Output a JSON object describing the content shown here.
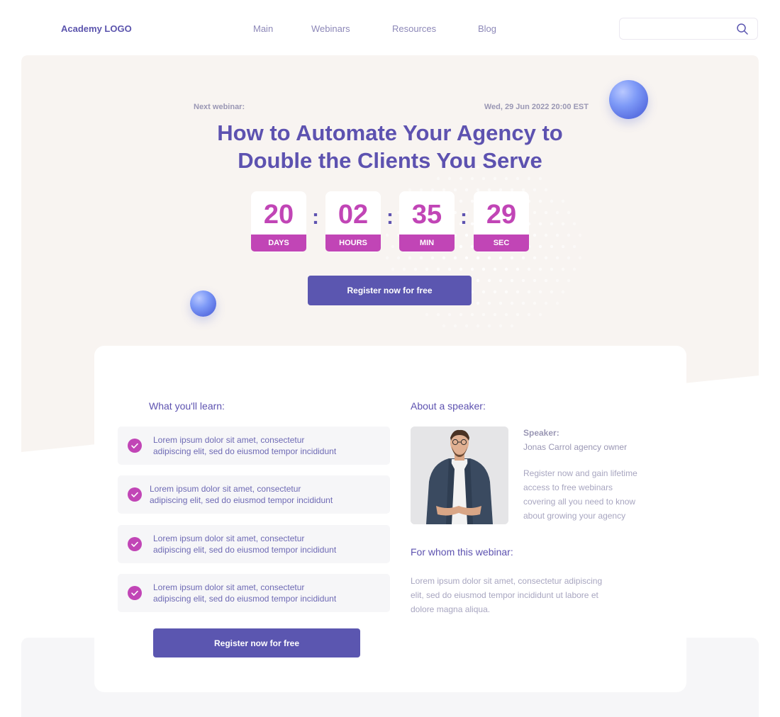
{
  "header": {
    "logo": "Academy LOGO",
    "nav": [
      "Main",
      "Webinars",
      "Resources",
      "Blog"
    ],
    "search_placeholder": ""
  },
  "hero": {
    "next_label": "Next webinar:",
    "date": "Wed, 29 Jun 2022 20:00 EST",
    "title_line1": "How to Automate Your Agency to",
    "title_line2": "Double the Clients You Serve",
    "countdown": [
      {
        "value": "20",
        "label": "DAYS"
      },
      {
        "value": "02",
        "label": "HOURS"
      },
      {
        "value": "35",
        "label": "MIN"
      },
      {
        "value": "29",
        "label": "SEC"
      }
    ],
    "separator": ":",
    "register_label": "Register now for free"
  },
  "learn": {
    "title": "What you'll learn:",
    "items": [
      {
        "line1": "Lorem ipsum dolor sit amet, consectetur",
        "line2": "adipiscing elit, sed do eiusmod tempor incididunt"
      },
      {
        "line1": "Lorem ipsum dolor sit amet, consectetur",
        "line2": "adipiscing elit, sed do eiusmod tempor incididunt"
      },
      {
        "line1": "Lorem ipsum dolor sit amet, consectetur",
        "line2": "adipiscing elit, sed do eiusmod tempor incididunt"
      },
      {
        "line1": "Lorem ipsum dolor sit amet, consectetur",
        "line2": "adipiscing elit, sed do eiusmod tempor incididunt"
      }
    ],
    "register_label": "Register now for free"
  },
  "speaker": {
    "title": "About a speaker:",
    "label": "Speaker:",
    "name": "Jonas Carrol agency owner",
    "desc_lines": [
      "Register now and gain lifetime",
      "access to free webinars",
      "covering all you need to know",
      "about growing your agency"
    ]
  },
  "whom": {
    "title": "For whom this webinar:",
    "lines": [
      "Lorem ipsum dolor sit amet, consectetur adipiscing",
      "elit, sed do eiusmod tempor incididunt ut labore et",
      "dolore magna aliqua."
    ]
  },
  "colors": {
    "accent": "#5b56b0",
    "magenta": "#c145b6",
    "hero_bg": "#f8f4f1"
  },
  "icons": [
    "search-icon",
    "check-icon",
    "sphere-decoration",
    "dots-pattern"
  ]
}
